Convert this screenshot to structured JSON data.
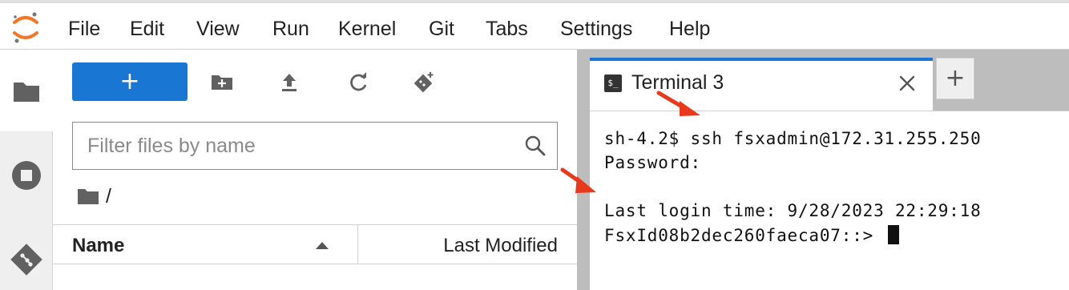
{
  "menubar": {
    "items": [
      "File",
      "Edit",
      "View",
      "Run",
      "Kernel",
      "Git",
      "Tabs",
      "Settings",
      "Help"
    ]
  },
  "activitybar": {
    "icons": [
      "folder-icon",
      "running-sessions-icon",
      "git-icon"
    ]
  },
  "filebrowser": {
    "new_button_label": "+",
    "filter_placeholder": "Filter files by name",
    "breadcrumb": "/",
    "columns": {
      "name": "Name",
      "modified": "Last Modified"
    }
  },
  "tabs": {
    "active_tab_label": "Terminal 3",
    "terminal_icon_text": "$_",
    "add_tab_label": "+"
  },
  "terminal": {
    "lines": [
      "sh-4.2$ ssh fsxadmin@172.31.255.250",
      "Password:",
      "",
      "Last login time: 9/28/2023 22:29:18",
      "FsxId08b2dec260faeca07::> "
    ]
  },
  "colors": {
    "accent": "#1976d2",
    "logo_orange": "#f37726",
    "arrow_red": "#e8391d"
  }
}
